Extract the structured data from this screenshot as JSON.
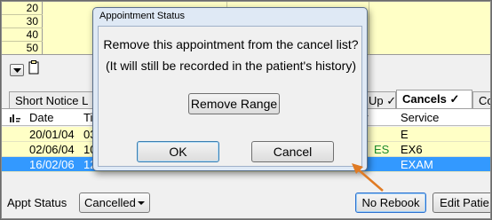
{
  "grid": {
    "time_labels": [
      "20",
      "30",
      "40",
      "50"
    ]
  },
  "tabs": [
    {
      "label": "Short Notice L"
    },
    {
      "label": "Up ✓"
    },
    {
      "label": "Cancels ✓"
    },
    {
      "label": "Cor"
    }
  ],
  "table": {
    "headers": {
      "date": "Date",
      "time": "Ti",
      "provider": "er",
      "service": "Service"
    },
    "rows": [
      {
        "date": "20/01/04",
        "time": "03",
        "provider": "",
        "service": "E"
      },
      {
        "date": "02/06/04",
        "time": "10",
        "provider": "ES",
        "service": "EX6"
      },
      {
        "date": "16/02/06",
        "time": "12",
        "provider": "",
        "service": "EXAM"
      }
    ],
    "provider_color": "#1a8a2a",
    "selected_color": "#3399ff"
  },
  "bottom": {
    "appt_status_label": "Appt Status",
    "appt_status_value": "Cancelled",
    "no_rebook": "No Rebook",
    "edit_patient": "Edit Patie"
  },
  "dialog": {
    "title": "Appointment Status",
    "message": "Remove this appointment from the cancel list?",
    "note": "(It will still be recorded in the patient's history)",
    "remove_range": "Remove Range",
    "ok": "OK",
    "cancel": "Cancel"
  },
  "icons": {
    "dropdown": "dropdown-arrow-icon",
    "clipboard": "clipboard-icon",
    "sort": "sort-icon",
    "callout": "orange-arrow-annotation"
  },
  "colors": {
    "annotation": "#e07b24",
    "grid_background": "#ffffc6"
  }
}
